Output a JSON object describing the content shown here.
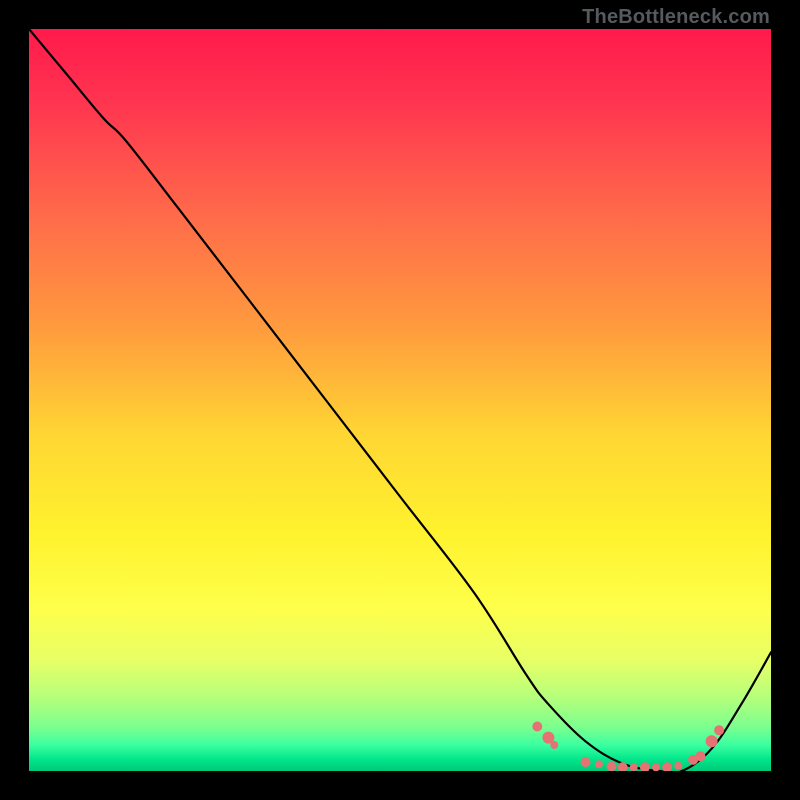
{
  "attribution": "TheBottleneck.com",
  "chart_data": {
    "type": "line",
    "title": "",
    "xlabel": "",
    "ylabel": "",
    "xlim": [
      0,
      100
    ],
    "ylim": [
      0,
      100
    ],
    "series": [
      {
        "name": "bottleneck-curve",
        "x": [
          0,
          5,
          10,
          13,
          20,
          30,
          40,
          50,
          60,
          67,
          70,
          75,
          80,
          85,
          88,
          92,
          96,
          100
        ],
        "y": [
          100,
          94,
          88,
          85,
          76,
          63,
          50,
          37,
          24,
          13,
          9,
          4,
          1,
          0,
          0,
          3,
          9,
          16
        ]
      }
    ],
    "markers": {
      "name": "highlighted-points",
      "color": "#e57373",
      "points": [
        {
          "x": 68.5,
          "y": 6.0,
          "r": 5
        },
        {
          "x": 70.0,
          "y": 4.5,
          "r": 6
        },
        {
          "x": 70.8,
          "y": 3.5,
          "r": 4
        },
        {
          "x": 75.0,
          "y": 1.2,
          "r": 5
        },
        {
          "x": 76.8,
          "y": 0.9,
          "r": 4
        },
        {
          "x": 78.5,
          "y": 0.6,
          "r": 5
        },
        {
          "x": 80.0,
          "y": 0.5,
          "r": 5
        },
        {
          "x": 81.5,
          "y": 0.5,
          "r": 4
        },
        {
          "x": 83.0,
          "y": 0.5,
          "r": 5
        },
        {
          "x": 84.5,
          "y": 0.5,
          "r": 4
        },
        {
          "x": 86.0,
          "y": 0.5,
          "r": 5
        },
        {
          "x": 87.5,
          "y": 0.7,
          "r": 4
        },
        {
          "x": 89.5,
          "y": 1.5,
          "r": 5
        },
        {
          "x": 90.5,
          "y": 2.0,
          "r": 5
        },
        {
          "x": 92.0,
          "y": 4.0,
          "r": 6
        },
        {
          "x": 93.0,
          "y": 5.5,
          "r": 5
        }
      ]
    },
    "gradient_stops": [
      {
        "offset": 0.0,
        "color": "#ff1a4b"
      },
      {
        "offset": 0.1,
        "color": "#ff3550"
      },
      {
        "offset": 0.25,
        "color": "#ff6a4a"
      },
      {
        "offset": 0.4,
        "color": "#ff9a3e"
      },
      {
        "offset": 0.55,
        "color": "#ffd733"
      },
      {
        "offset": 0.68,
        "color": "#fff22e"
      },
      {
        "offset": 0.78,
        "color": "#feff4a"
      },
      {
        "offset": 0.85,
        "color": "#e8ff66"
      },
      {
        "offset": 0.9,
        "color": "#b6ff7a"
      },
      {
        "offset": 0.94,
        "color": "#7dff8e"
      },
      {
        "offset": 0.965,
        "color": "#3bffa0"
      },
      {
        "offset": 0.985,
        "color": "#00e58a"
      },
      {
        "offset": 1.0,
        "color": "#00c878"
      }
    ]
  }
}
